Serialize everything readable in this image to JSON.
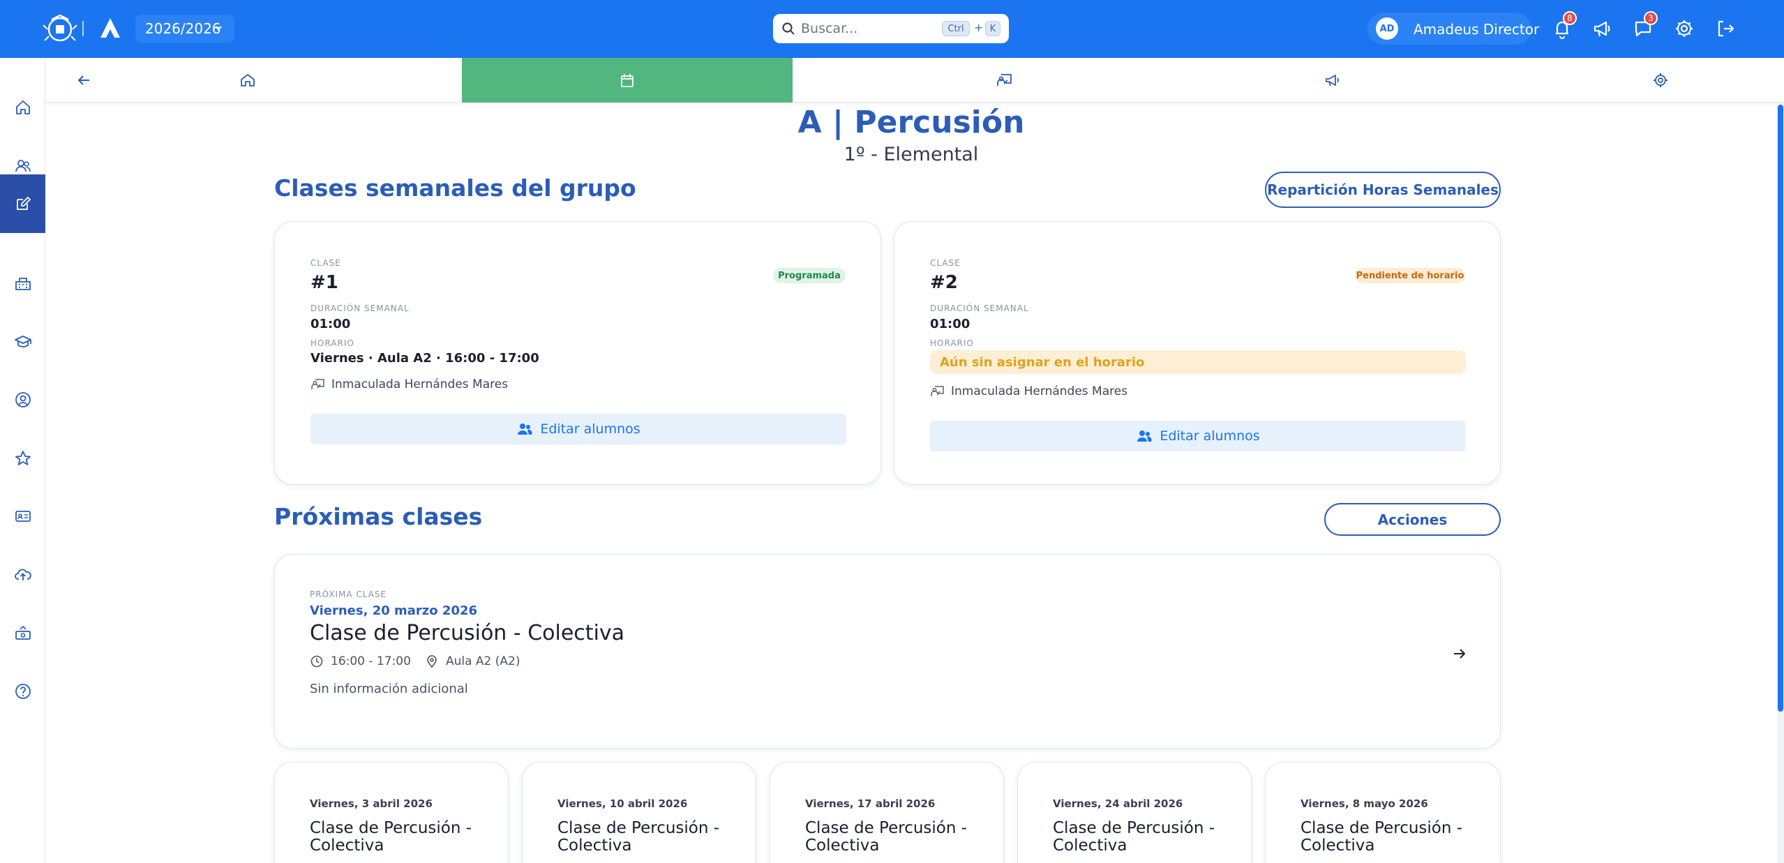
{
  "app": {
    "year": "2026/2026",
    "search_placeholder": "Buscar...",
    "kbd_ctrl": "Ctrl",
    "kbd_plus": "+",
    "kbd_k": "K",
    "user_initials": "AD",
    "user_name": "Amadeus Director",
    "notif_count": "8",
    "messages_count": "3"
  },
  "header": {
    "title": "A | Percusión",
    "subtitle": "1º - Elemental"
  },
  "weekly": {
    "title": "Clases semanales del grupo",
    "split_button": "Repartición Horas Semanales",
    "cards": [
      {
        "class_label": "CLASE",
        "class_number": "#1",
        "status": "Programada",
        "duration_label": "DURACIÓN SEMANAL",
        "duration": "01:00",
        "schedule_label": "HORARIO",
        "schedule": "Viernes · Aula A2 · 16:00 - 17:00",
        "teacher": "Inmaculada Hernándes Mares",
        "edit_label": "Editar alumnos"
      },
      {
        "class_label": "CLASE",
        "class_number": "#2",
        "status": "Pendiente de horario",
        "duration_label": "DURACIÓN SEMANAL",
        "duration": "01:00",
        "schedule_label": "HORARIO",
        "schedule_warning": "Aún sin asignar en el horario",
        "teacher": "Inmaculada Hernándes Mares",
        "edit_label": "Editar alumnos"
      }
    ]
  },
  "upcoming": {
    "title": "Próximas clases",
    "actions_button": "Acciones",
    "next": {
      "label": "PRÓXIMA CLASE",
      "date": "Viernes, 20 marzo 2026",
      "name": "Clase de Percusión - Colectiva",
      "time": "16:00 - 17:00",
      "room": "Aula A2 (A2)",
      "info": "Sin información adicional"
    },
    "list": [
      {
        "date": "Viernes, 3 abril 2026",
        "name": "Clase de Percusión - Colectiva"
      },
      {
        "date": "Viernes, 10 abril 2026",
        "name": "Clase de Percusión - Colectiva"
      },
      {
        "date": "Viernes, 17 abril 2026",
        "name": "Clase de Percusión - Colectiva"
      },
      {
        "date": "Viernes, 24 abril 2026",
        "name": "Clase de Percusión - Colectiva"
      },
      {
        "date": "Viernes, 8 mayo 2026",
        "name": "Clase de Percusión - Colectiva"
      }
    ]
  },
  "colors": {
    "topbar": "#1b74f0",
    "accent": "#2b5db8",
    "active_tab": "#52b77f",
    "sidebar_active": "#2b4fa8"
  },
  "icons": {
    "sidebar": [
      "home-icon",
      "users-icon",
      "edit-icon",
      "school-icon",
      "graduation-icon",
      "profile-icon",
      "star-icon",
      "id-card-icon",
      "cloud-upload-icon",
      "money-icon",
      "help-icon"
    ],
    "tabs": [
      "back-arrow-icon",
      "home-icon",
      "calendar-icon",
      "teacher-board-icon",
      "megaphone-icon",
      "gear-icon"
    ],
    "topbar": [
      "bell-icon",
      "megaphone-icon",
      "chat-icon",
      "gear-icon",
      "logout-icon"
    ]
  }
}
